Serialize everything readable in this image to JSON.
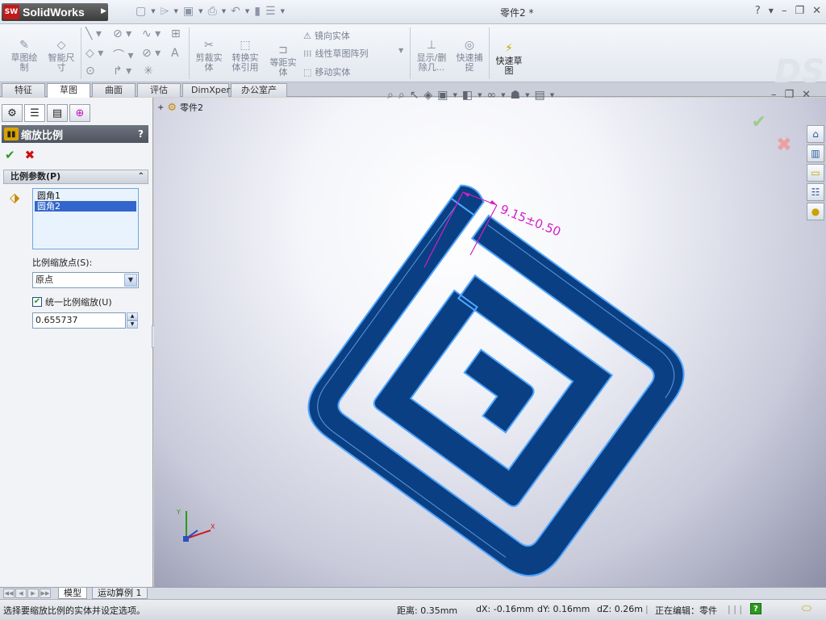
{
  "app": {
    "brand": "SolidWorks",
    "brand_mark": "SW",
    "window_title": "零件2 *",
    "help": "?",
    "minimize": "–",
    "restore": "❐",
    "close": "✕"
  },
  "ribbon": {
    "sketch": "草图绘\n制",
    "smart_dim": "智能尺\n寸",
    "trim": "剪裁实\n体",
    "convert": "转换实\n体引用",
    "offset": "等距实\n体",
    "mirror": "镜向实体",
    "linear_pattern": "线性草图阵列",
    "move": "移动实体",
    "show_delete": "显示/删\n除几...",
    "quick_snap": "快速捕\n捉",
    "rapid_sketch": "快速草\n图"
  },
  "tabs": [
    "特征",
    "草图",
    "曲面",
    "评估",
    "DimXpert",
    "办公室产品"
  ],
  "active_tab": 1,
  "property_manager": {
    "title": "缩放比例",
    "help": "?",
    "ok": "✔",
    "cancel": "✖",
    "group_title": "比例参数(P)",
    "collapse": "⌃",
    "entities": [
      {
        "label": "圆角1",
        "selected": false
      },
      {
        "label": "圆角2",
        "selected": true
      }
    ],
    "scale_point_label": "比例缩放点(S):",
    "scale_point_value": "原点",
    "uniform_label": "统一比例缩放(U)",
    "uniform_checked": true,
    "scale_value": "0.655737"
  },
  "viewport": {
    "tree_root": "零件2",
    "dimension_text": "9.15±0.50",
    "colors": {
      "part_fill": "#0b3f83",
      "part_edge": "#4fa6ff",
      "dimension": "#d21ec8"
    }
  },
  "bottom_tabs": [
    "模型",
    "运动算例 1"
  ],
  "active_bottom_tab": 0,
  "status": {
    "message": "选择要缩放比例的实体并设定选项。",
    "distance": "距离: 0.35mm",
    "dx": "dX: -0.16mm",
    "dy": "dY: 0.16mm",
    "dz": "dZ: 0.26m",
    "editing": "正在编辑：零件"
  }
}
